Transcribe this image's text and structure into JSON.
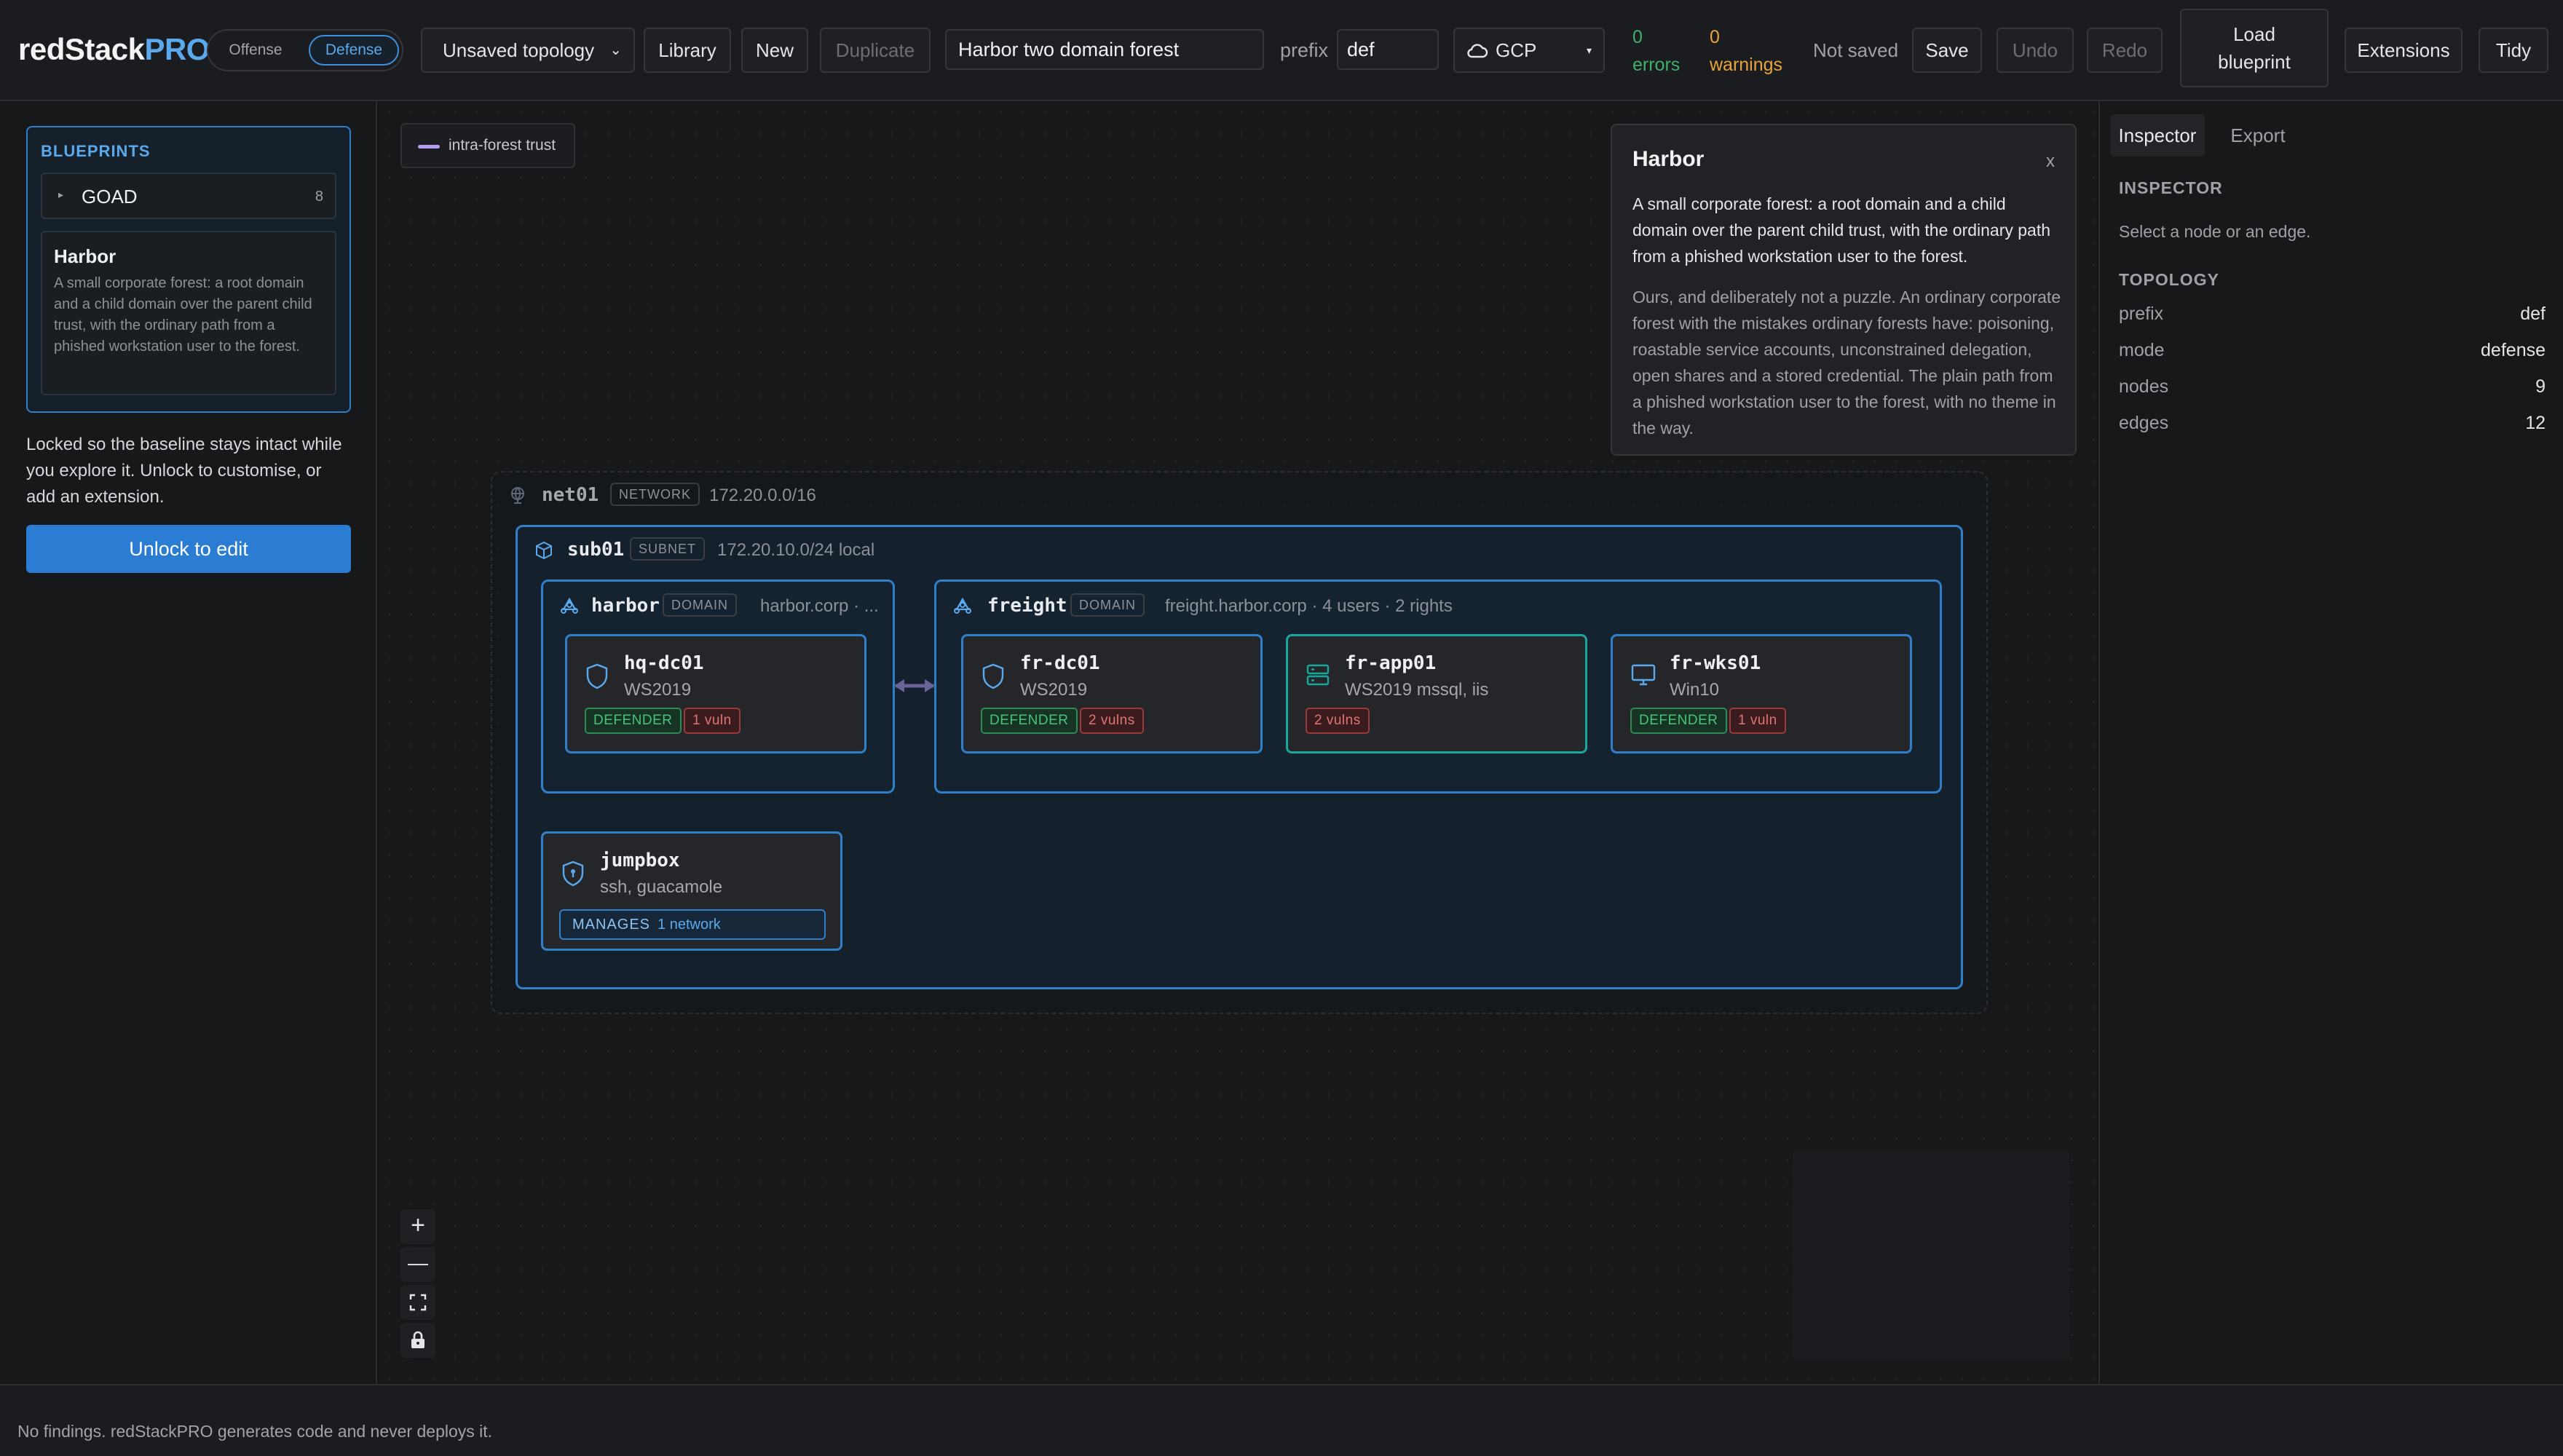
{
  "brand": {
    "name": "redStack",
    "suffix": "PRO"
  },
  "mode": {
    "offense": "Offense",
    "defense": "Defense"
  },
  "toolbar": {
    "topology_select": "Unsaved topology",
    "library": "Library",
    "new": "New",
    "duplicate": "Duplicate",
    "topology_name": "Harbor two domain forest",
    "prefix_label": "prefix",
    "prefix_value": "def",
    "cloud": "GCP",
    "errors_count": "0",
    "errors_label": "errors",
    "warnings_count": "0",
    "warnings_label": "warnings",
    "save_state": "Not saved",
    "save": "Save",
    "undo": "Undo",
    "redo": "Redo",
    "load_blueprint_line1": "Load",
    "load_blueprint_line2": "blueprint",
    "extensions": "Extensions",
    "tidy": "Tidy"
  },
  "sidebar": {
    "title": "BLUEPRINTS",
    "group": {
      "name": "GOAD",
      "count": "8"
    },
    "card": {
      "title": "Harbor",
      "description": "A small corporate forest: a root domain and a child domain over the parent child trust, with the ordinary path from a phished workstation user to the forest."
    },
    "locked_text": "Locked so the baseline stays intact while you explore it. Unlock to customise, or add an extension.",
    "unlock": "Unlock to edit"
  },
  "canvas": {
    "legend": "intra-forest trust",
    "network": {
      "name": "net01",
      "tag": "NETWORK",
      "cidr": "172.20.0.0/16"
    },
    "subnet": {
      "name": "sub01",
      "tag": "SUBNET",
      "cidr": "172.20.10.0/24 local"
    },
    "domains": [
      {
        "name": "harbor",
        "tag": "DOMAIN",
        "info": "harbor.corp · ..."
      },
      {
        "name": "freight",
        "tag": "DOMAIN",
        "info": "freight.harbor.corp · 4 users · 2 rights"
      }
    ],
    "hosts": [
      {
        "name": "hq-dc01",
        "os": "WS2019",
        "defender": "DEFENDER",
        "vulns": "1 vuln"
      },
      {
        "name": "fr-dc01",
        "os": "WS2019",
        "defender": "DEFENDER",
        "vulns": "2 vulns"
      },
      {
        "name": "fr-app01",
        "os": "WS2019 mssql, iis",
        "vulns": "2 vulns"
      },
      {
        "name": "fr-wks01",
        "os": "Win10",
        "defender": "DEFENDER",
        "vulns": "1 vuln"
      }
    ],
    "jumpbox": {
      "name": "jumpbox",
      "services": "ssh, guacamole",
      "manages_label": "MANAGES",
      "manages_value": "1 network"
    },
    "zoom": {
      "in": "+",
      "out": "—"
    }
  },
  "popup": {
    "title": "Harbor",
    "close": "x",
    "summary": "A small corporate forest: a root domain and a child domain over the parent child trust, with the ordinary path from a phished workstation user to the forest.",
    "detail": "Ours, and deliberately not a puzzle. An ordinary corporate forest with the mistakes ordinary forests have: poisoning, roastable service accounts, unconstrained delegation, open shares and a stored credential. The plain path from a phished workstation user to the forest, with no theme in the way."
  },
  "inspector": {
    "tabs": [
      "Inspector",
      "Export"
    ],
    "heading": "INSPECTOR",
    "hint": "Select a node or an edge.",
    "topology_heading": "TOPOLOGY",
    "rows": [
      {
        "k": "prefix",
        "v": "def"
      },
      {
        "k": "mode",
        "v": "defense"
      },
      {
        "k": "nodes",
        "v": "9"
      },
      {
        "k": "edges",
        "v": "12"
      }
    ]
  },
  "footer": "No findings. redStackPRO generates code and never deploys it.",
  "colors": {
    "accent": "#2f7fcb",
    "trust": "#b39ef0",
    "ok": "#46c27a",
    "warn": "#e8a43a",
    "vuln": "#e07474",
    "teal": "#18a79b"
  }
}
